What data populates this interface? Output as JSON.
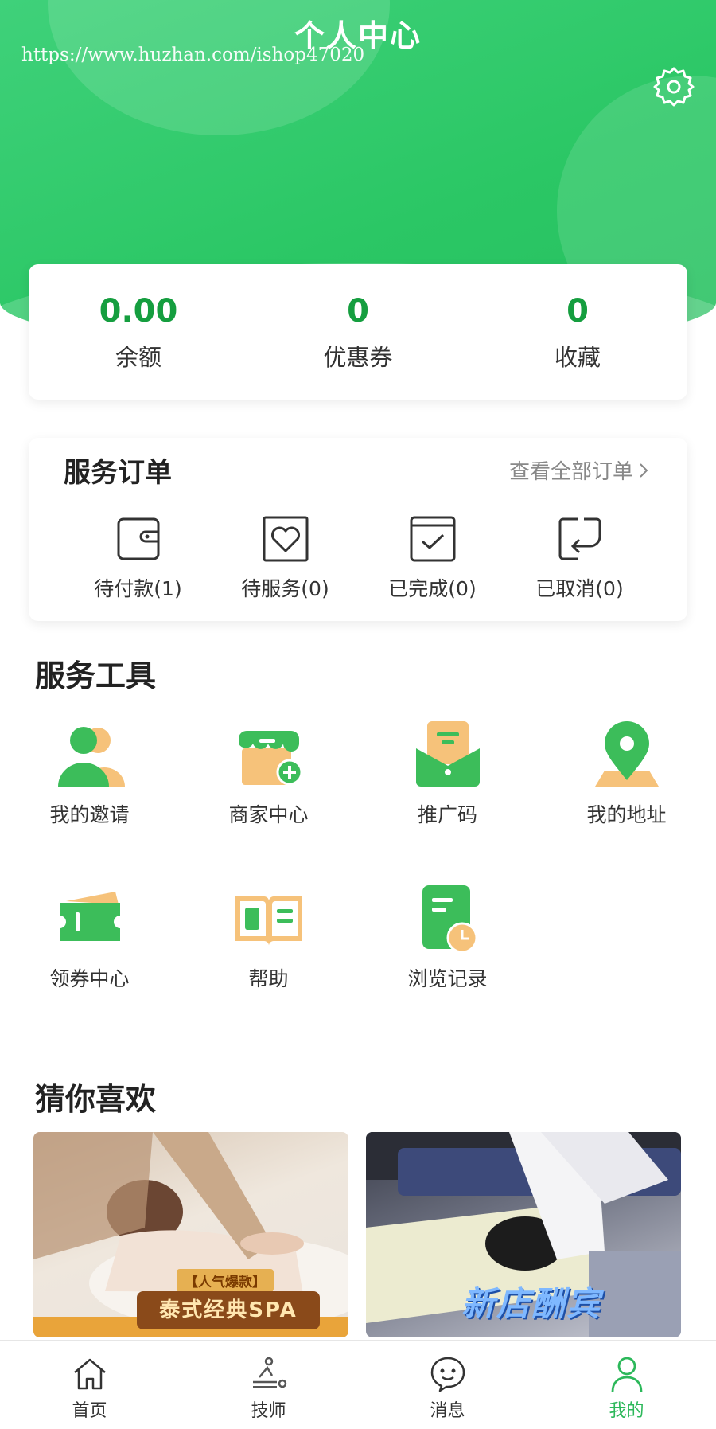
{
  "header": {
    "title": "个人中心",
    "watermark": "https://www.huzhan.com/ishop47020",
    "settings_icon": "gear-icon"
  },
  "stats": [
    {
      "value": "0.00",
      "label": "余额"
    },
    {
      "value": "0",
      "label": "优惠券"
    },
    {
      "value": "0",
      "label": "收藏"
    }
  ],
  "orders": {
    "title": "服务订单",
    "view_all": "查看全部订单",
    "items": [
      {
        "label": "待付款(1)",
        "icon": "wallet-icon"
      },
      {
        "label": "待服务(0)",
        "icon": "heart-box-icon"
      },
      {
        "label": "已完成(0)",
        "icon": "check-box-icon"
      },
      {
        "label": "已取消(0)",
        "icon": "return-icon"
      }
    ]
  },
  "tools": {
    "title": "服务工具",
    "items": [
      {
        "label": "我的邀请",
        "icon": "people-icon"
      },
      {
        "label": "商家中心",
        "icon": "shop-icon"
      },
      {
        "label": "推广码",
        "icon": "envelope-icon"
      },
      {
        "label": "我的地址",
        "icon": "location-pin-icon"
      },
      {
        "label": "领券中心",
        "icon": "coupon-icon"
      },
      {
        "label": "帮助",
        "icon": "book-icon"
      },
      {
        "label": "浏览记录",
        "icon": "history-icon"
      }
    ]
  },
  "recommend": {
    "title": "猜你喜欢",
    "items": [
      {
        "badge_top": "【人气爆款】",
        "badge": "泰式经典SPA"
      },
      {
        "overlay": "新店酬宾"
      }
    ]
  },
  "tabbar": {
    "items": [
      {
        "label": "首页",
        "icon": "home-icon"
      },
      {
        "label": "技师",
        "icon": "massage-icon"
      },
      {
        "label": "消息",
        "icon": "chat-icon"
      },
      {
        "label": "我的",
        "icon": "user-icon"
      }
    ],
    "active_color": "#2cb85a"
  },
  "colors": {
    "brand_green": "#2bc765",
    "stat_green": "#159e3f",
    "accent_orange": "#f6c27a"
  }
}
